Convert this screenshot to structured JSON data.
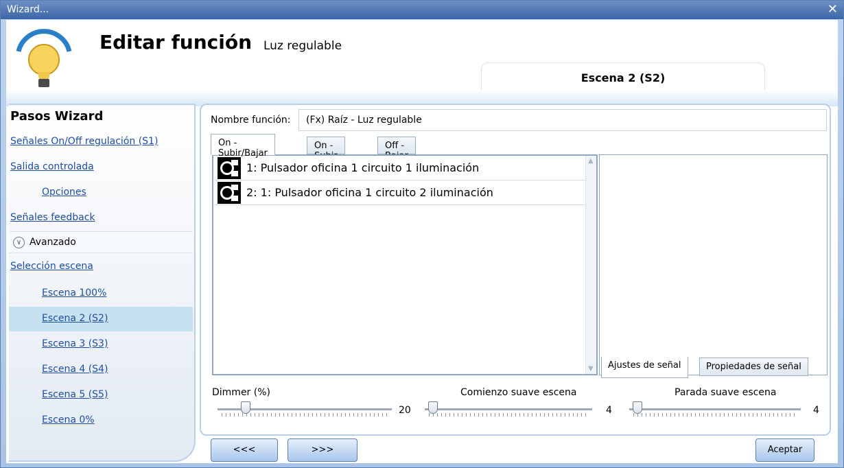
{
  "window": {
    "title": "Wizard...",
    "close_icon": "close-icon"
  },
  "header": {
    "title": "Editar función",
    "subtitle": "Luz regulable",
    "icon": "lightbulb-icon",
    "scene_tab": "Escena 2 (S2)"
  },
  "sidebar": {
    "title": "Pasos Wizard",
    "items": [
      {
        "label": "Señales On/Off regulación (S1)"
      },
      {
        "label": "Salida controlada"
      },
      {
        "label": "Opciones"
      },
      {
        "label": "Señales feedback"
      }
    ],
    "advanced_label": "Avanzado",
    "advanced_items": [
      {
        "label": "Selección escena"
      },
      {
        "label": "Escena 100%"
      },
      {
        "label": "Escena 2 (S2)",
        "selected": true
      },
      {
        "label": "Escena 3 (S3)"
      },
      {
        "label": "Escena 4 (S4)"
      },
      {
        "label": "Escena 5 (S5)"
      },
      {
        "label": "Escena 0%"
      }
    ]
  },
  "main": {
    "name_label": "Nombre función:",
    "name_value": "(Fx) Raíz - Luz regulable",
    "tabs": [
      {
        "label": "On - Subir/Bajar",
        "active": true
      },
      {
        "label": "On - Subir"
      },
      {
        "label": "Off - Bajar"
      }
    ],
    "signals": [
      {
        "text": "1: Pulsador oficina 1 circuito 1 iluminación",
        "icon": "pushbutton-icon"
      },
      {
        "text": "2: 1: Pulsador oficina 1 circuito 2 iluminación",
        "icon": "pushbutton-icon"
      }
    ],
    "right_tabs": [
      {
        "label": "Ajustes de señal",
        "active": true
      },
      {
        "label": "Propiedades de señal"
      }
    ],
    "sliders": [
      {
        "label": "Dimmer (%)",
        "value": "20",
        "level": 0.14
      },
      {
        "label": "Comienzo suave escena",
        "value": "4",
        "level": 0.02
      },
      {
        "label": "Parada suave escena",
        "value": "4",
        "level": 0.02
      }
    ]
  },
  "footer": {
    "back_label": "<<<",
    "next_label": ">>>",
    "accept_label": "Aceptar"
  },
  "colors": {
    "link": "#1f4ea3",
    "selected": "#c6e1ef",
    "titlebar": "#3c66a8"
  }
}
